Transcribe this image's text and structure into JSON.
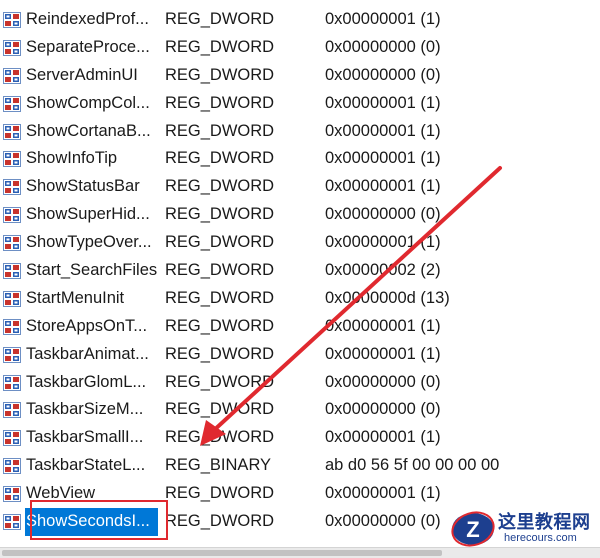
{
  "registry_values": [
    {
      "name": "ReindexedProf...",
      "type": "REG_DWORD",
      "data": "0x00000001 (1)"
    },
    {
      "name": "SeparateProce...",
      "type": "REG_DWORD",
      "data": "0x00000000 (0)"
    },
    {
      "name": "ServerAdminUI",
      "type": "REG_DWORD",
      "data": "0x00000000 (0)"
    },
    {
      "name": "ShowCompCol...",
      "type": "REG_DWORD",
      "data": "0x00000001 (1)"
    },
    {
      "name": "ShowCortanaB...",
      "type": "REG_DWORD",
      "data": "0x00000001 (1)"
    },
    {
      "name": "ShowInfoTip",
      "type": "REG_DWORD",
      "data": "0x00000001 (1)"
    },
    {
      "name": "ShowStatusBar",
      "type": "REG_DWORD",
      "data": "0x00000001 (1)"
    },
    {
      "name": "ShowSuperHid...",
      "type": "REG_DWORD",
      "data": "0x00000000 (0)"
    },
    {
      "name": "ShowTypeOver...",
      "type": "REG_DWORD",
      "data": "0x00000001 (1)"
    },
    {
      "name": "Start_SearchFiles",
      "type": "REG_DWORD",
      "data": "0x00000002 (2)"
    },
    {
      "name": "StartMenuInit",
      "type": "REG_DWORD",
      "data": "0x0000000d (13)"
    },
    {
      "name": "StoreAppsOnT...",
      "type": "REG_DWORD",
      "data": "0x00000001 (1)"
    },
    {
      "name": "TaskbarAnimat...",
      "type": "REG_DWORD",
      "data": "0x00000001 (1)"
    },
    {
      "name": "TaskbarGlomL...",
      "type": "REG_DWORD",
      "data": "0x00000000 (0)"
    },
    {
      "name": "TaskbarSizeM...",
      "type": "REG_DWORD",
      "data": "0x00000000 (0)"
    },
    {
      "name": "TaskbarSmallI...",
      "type": "REG_DWORD",
      "data": "0x00000001 (1)"
    },
    {
      "name": "TaskbarStateL...",
      "type": "REG_BINARY",
      "data": "ab d0 56 5f 00 00 00 00"
    },
    {
      "name": "WebView",
      "type": "REG_DWORD",
      "data": "0x00000001 (1)"
    },
    {
      "name": "ShowSecondsI...",
      "type": "REG_DWORD",
      "data": "0x00000000 (0)",
      "selected": true
    }
  ],
  "icons": {
    "value_icon": "registry-dword-value-icon"
  },
  "colors": {
    "selection": "#0078d7",
    "annotation": "#e0292f",
    "icon_blue": "#2b5fb4",
    "icon_red": "#c8332c"
  },
  "watermark": {
    "title": "这里教程网",
    "url": "herecours.com",
    "logo_letter": "Z"
  }
}
